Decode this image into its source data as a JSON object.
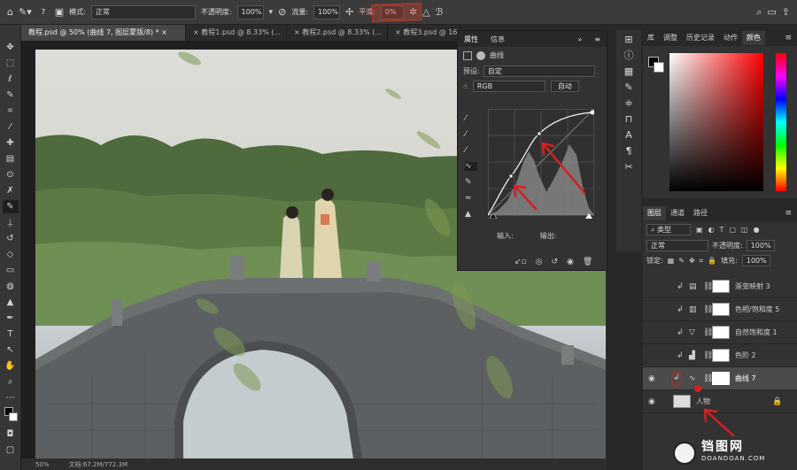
{
  "options_bar": {
    "brush_size": "7",
    "mode_label": "模式:",
    "mode_value": "正常",
    "opacity_label": "不透明度:",
    "opacity_value": "100%",
    "flow_label": "流量:",
    "flow_value": "100%",
    "smooth_label": "平滑:",
    "smooth_value": "0%"
  },
  "doc_tabs": [
    {
      "label": "教程.psd @ 50% (曲线 7, 图层蒙版/8) *"
    },
    {
      "label": "教程1.psd @ 8.33% (..."
    },
    {
      "label": "教程2.psd @ 8.33% (..."
    },
    {
      "label": "教程3.psd @ 16..."
    }
  ],
  "status": {
    "zoom": "50%",
    "doc": "文档:67.2M/772.3M"
  },
  "properties": {
    "tab_properties": "属性",
    "tab_info": "信息",
    "title": "曲线",
    "preset_label": "预设:",
    "preset_value": "自定",
    "channel": "RGB",
    "auto_label": "自动",
    "input_label": "输入:",
    "output_label": "输出:"
  },
  "color_panel": {
    "tabs": [
      "库",
      "调整",
      "历史记录",
      "动作",
      "颜色"
    ],
    "active_tab": "颜色"
  },
  "layers_panel": {
    "tabs": [
      "图层",
      "通道",
      "路径"
    ],
    "filter_label": "类型",
    "blend_mode": "正常",
    "opacity_label": "不透明度:",
    "opacity_value": "100%",
    "lock_label": "锁定:",
    "fill_label": "填充:",
    "fill_value": "100%",
    "layers": [
      {
        "name": "渐变映射 3"
      },
      {
        "name": "色相/饱和度 5"
      },
      {
        "name": "自然饱和度 1"
      },
      {
        "name": "色阶 2"
      },
      {
        "name": "曲线 7"
      },
      {
        "name": "人物"
      }
    ]
  },
  "watermark": {
    "brand": "铛图网",
    "url": "DOANDOAN.COM"
  },
  "colors": {
    "accent_red": "#d42020",
    "selected_layer": "#4b4b4b"
  }
}
